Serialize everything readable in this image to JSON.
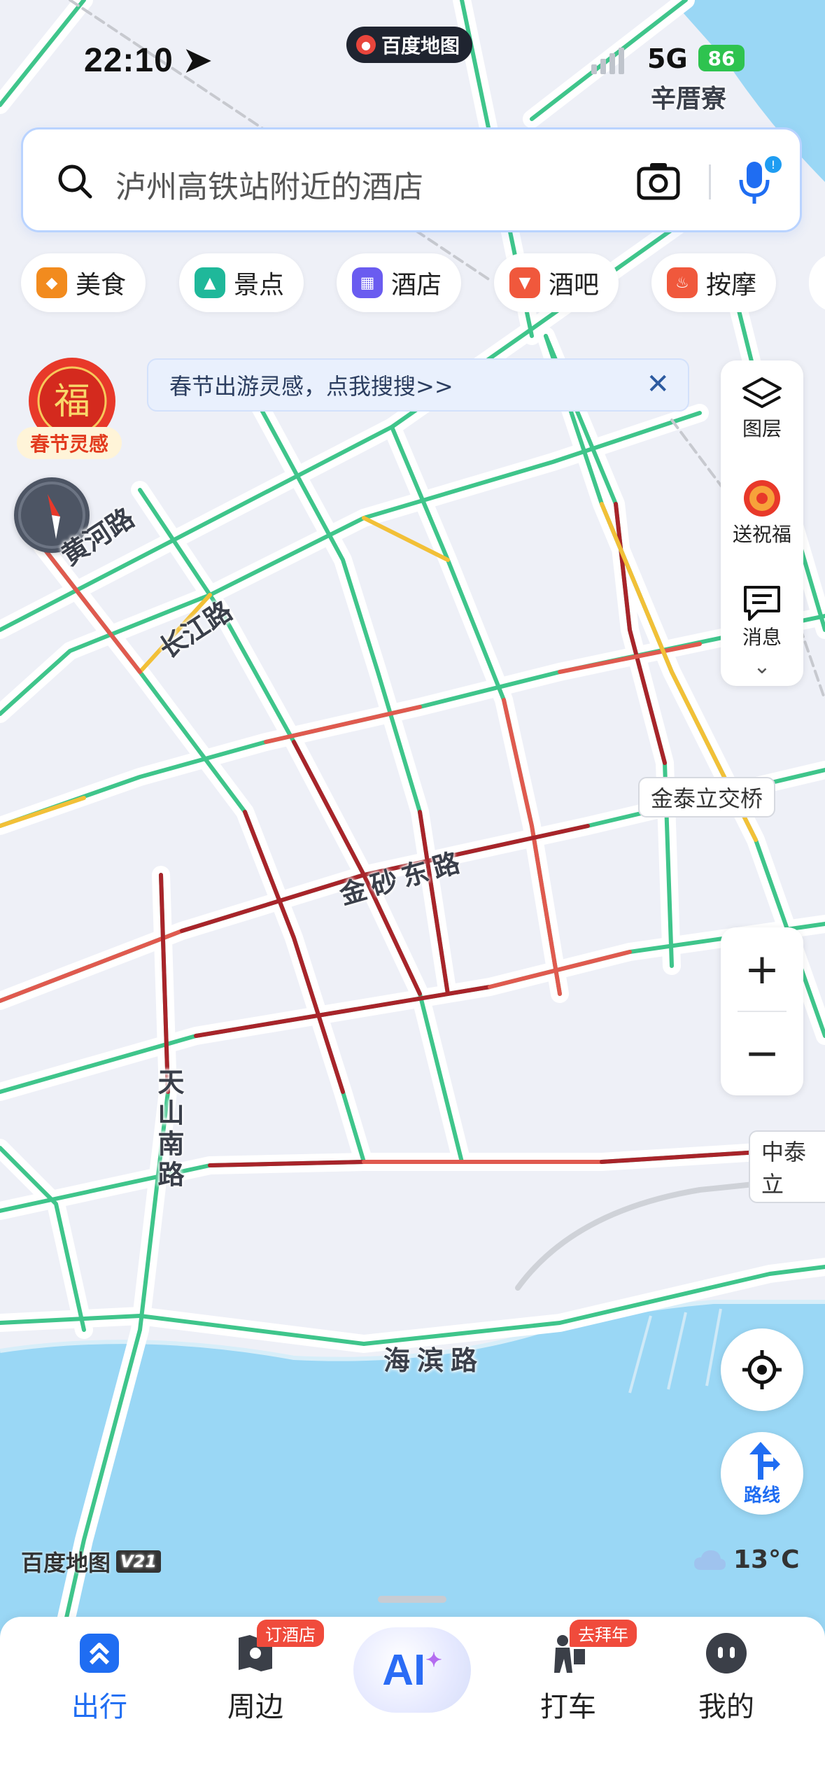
{
  "status_bar": {
    "time": "22:10",
    "app_name": "百度地图",
    "network": "5G",
    "battery": "86"
  },
  "search": {
    "placeholder": "泸州高铁站附近的酒店"
  },
  "categories": [
    {
      "label": "美食",
      "icon": "food-icon",
      "color": "#f28b1e"
    },
    {
      "label": "景点",
      "icon": "scenic-icon",
      "color": "#1fb89a"
    },
    {
      "label": "酒店",
      "icon": "hotel-icon",
      "color": "#6a5cf0"
    },
    {
      "label": "酒吧",
      "icon": "bar-icon",
      "color": "#f0583c"
    },
    {
      "label": "按摩",
      "icon": "massage-icon",
      "color": "#f0583c"
    }
  ],
  "banner": {
    "text": "春节出游灵感，点我搜搜>>"
  },
  "festival": {
    "char": "福",
    "label": "春节灵感"
  },
  "right_panel": {
    "layers": "图层",
    "blessing": "送祝福",
    "messages": "消息"
  },
  "map": {
    "roads": [
      {
        "name": "黄河路"
      },
      {
        "name": "长江路"
      },
      {
        "name": "金砂东路"
      },
      {
        "name": "天山南路"
      },
      {
        "name": "海滨路"
      }
    ],
    "pois": [
      "辛厝寮",
      "金泰立交桥",
      "中泰立"
    ]
  },
  "logo": {
    "text": "百度地图",
    "version": "V21"
  },
  "weather": {
    "temp": "13°C"
  },
  "route_button": "路线",
  "tabs": [
    {
      "label": "出行",
      "active": true
    },
    {
      "label": "周边",
      "badge": "订酒店"
    },
    {
      "label": "AI"
    },
    {
      "label": "打车",
      "badge": "去拜年"
    },
    {
      "label": "我的"
    }
  ],
  "colors": {
    "accent": "#1f6df2",
    "road_green": "#3fc58b",
    "road_yellow": "#f2c037",
    "road_red": "#e05a4f",
    "road_darkred": "#a8242a",
    "water": "#9ad7f5"
  }
}
